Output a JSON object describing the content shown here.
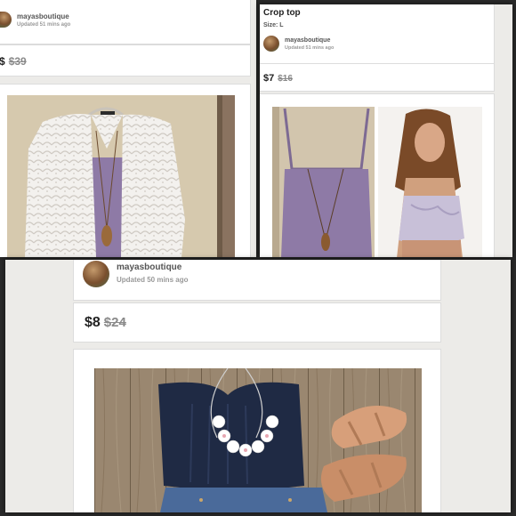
{
  "panel1": {
    "seller_name": "mayasboutique",
    "updated": "Updated 51 mins ago",
    "price_fragment": "$",
    "original_price": "$39"
  },
  "panel2": {
    "title": "Crop top",
    "size": "Size: L",
    "seller_name": "mayasboutique",
    "updated": "Updated 51 mins ago",
    "price": "$7",
    "original_price": "$16"
  },
  "panel3": {
    "seller_name": "mayasboutique",
    "updated": "Updated 50 mins ago",
    "price": "$8",
    "original_price": "$24"
  },
  "colors": {
    "background": "#ecebe8",
    "card": "#ffffff",
    "lavender": "#8e7aa6",
    "navy_top": "#1f2a44",
    "denim": "#4a6a9a",
    "sandal": "#d79f7a",
    "wood": "#9a8770"
  }
}
